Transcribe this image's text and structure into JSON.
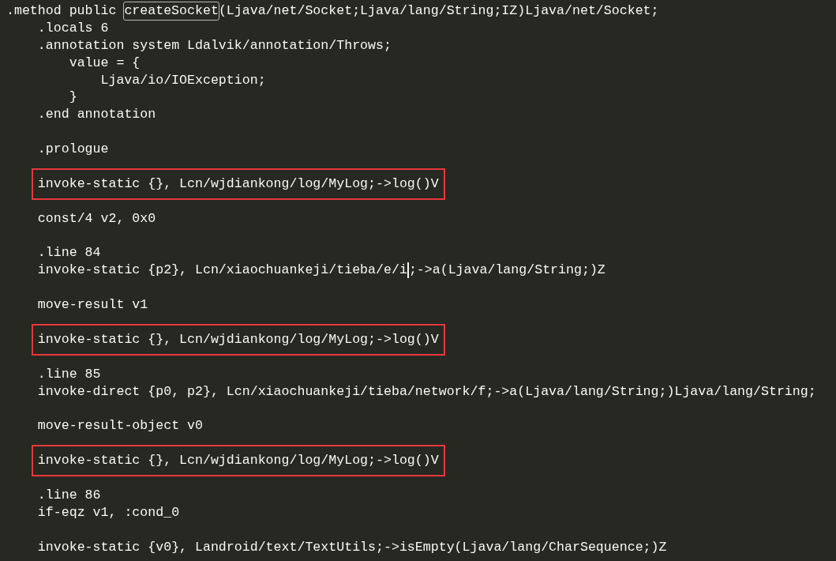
{
  "editor": {
    "lines": [
      {
        "kind": "code",
        "highlighted": false,
        "parts": [
          {
            "kind": "text",
            "text": ".method public "
          },
          {
            "kind": "match",
            "text": "createSocket"
          },
          {
            "kind": "text",
            "text": "(Ljava/net/Socket;Ljava/lang/String;IZ)Ljava/net/Socket;"
          }
        ]
      },
      {
        "kind": "code",
        "highlighted": false,
        "parts": [
          {
            "kind": "text",
            "text": "    .locals 6"
          }
        ]
      },
      {
        "kind": "code",
        "highlighted": false,
        "parts": [
          {
            "kind": "text",
            "text": "    .annotation system Ldalvik/annotation/Throws;"
          }
        ]
      },
      {
        "kind": "code",
        "highlighted": false,
        "parts": [
          {
            "kind": "text",
            "text": "        value = {"
          }
        ]
      },
      {
        "kind": "code",
        "highlighted": false,
        "parts": [
          {
            "kind": "text",
            "text": "            Ljava/io/IOException;"
          }
        ]
      },
      {
        "kind": "code",
        "highlighted": false,
        "parts": [
          {
            "kind": "text",
            "text": "        }"
          }
        ]
      },
      {
        "kind": "code",
        "highlighted": false,
        "parts": [
          {
            "kind": "text",
            "text": "    .end annotation"
          }
        ]
      },
      {
        "kind": "blank"
      },
      {
        "kind": "code",
        "highlighted": false,
        "parts": [
          {
            "kind": "text",
            "text": "    .prologue"
          }
        ]
      },
      {
        "kind": "blank"
      },
      {
        "kind": "code",
        "highlighted": true,
        "parts": [
          {
            "kind": "text",
            "text": "    invoke-static {}, Lcn/wjdiankong/log/MyLog;->log()V"
          }
        ]
      },
      {
        "kind": "blank"
      },
      {
        "kind": "code",
        "highlighted": false,
        "parts": [
          {
            "kind": "text",
            "text": "    const/4 v2, 0x0"
          }
        ]
      },
      {
        "kind": "blank"
      },
      {
        "kind": "code",
        "highlighted": false,
        "parts": [
          {
            "kind": "text",
            "text": "    .line 84"
          }
        ]
      },
      {
        "kind": "code",
        "highlighted": false,
        "parts": [
          {
            "kind": "text",
            "text": "    invoke-static {p2}, Lcn/xiaochuankeji/tieba/e/i"
          },
          {
            "kind": "caret"
          },
          {
            "kind": "text",
            "text": ";->a(Ljava/lang/String;)Z"
          }
        ]
      },
      {
        "kind": "blank"
      },
      {
        "kind": "code",
        "highlighted": false,
        "parts": [
          {
            "kind": "text",
            "text": "    move-result v1"
          }
        ]
      },
      {
        "kind": "blank"
      },
      {
        "kind": "code",
        "highlighted": true,
        "parts": [
          {
            "kind": "text",
            "text": "    invoke-static {}, Lcn/wjdiankong/log/MyLog;->log()V"
          }
        ]
      },
      {
        "kind": "blank"
      },
      {
        "kind": "code",
        "highlighted": false,
        "parts": [
          {
            "kind": "text",
            "text": "    .line 85"
          }
        ]
      },
      {
        "kind": "code",
        "highlighted": false,
        "parts": [
          {
            "kind": "text",
            "text": "    invoke-direct {p0, p2}, Lcn/xiaochuankeji/tieba/network/f;->a(Ljava/lang/String;)Ljava/lang/String;"
          }
        ]
      },
      {
        "kind": "blank"
      },
      {
        "kind": "code",
        "highlighted": false,
        "parts": [
          {
            "kind": "text",
            "text": "    move-result-object v0"
          }
        ]
      },
      {
        "kind": "blank"
      },
      {
        "kind": "code",
        "highlighted": true,
        "parts": [
          {
            "kind": "text",
            "text": "    invoke-static {}, Lcn/wjdiankong/log/MyLog;->log()V"
          }
        ]
      },
      {
        "kind": "blank"
      },
      {
        "kind": "code",
        "highlighted": false,
        "parts": [
          {
            "kind": "text",
            "text": "    .line 86"
          }
        ]
      },
      {
        "kind": "code",
        "highlighted": false,
        "parts": [
          {
            "kind": "text",
            "text": "    if-eqz v1, :cond_0"
          }
        ]
      },
      {
        "kind": "blank"
      },
      {
        "kind": "code",
        "highlighted": false,
        "parts": [
          {
            "kind": "text",
            "text": "    invoke-static {v0}, Landroid/text/TextUtils;->isEmpty(Ljava/lang/CharSequence;)Z"
          }
        ]
      }
    ]
  }
}
